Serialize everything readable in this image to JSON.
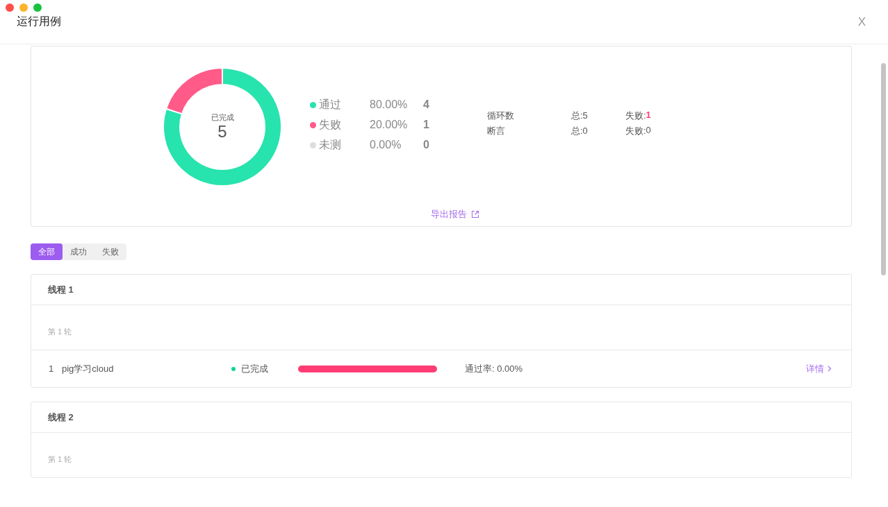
{
  "window": {
    "title": "运行用例",
    "close": "X"
  },
  "summary": {
    "chart_data": {
      "type": "donut",
      "categories": [
        "通过",
        "失败",
        "未测"
      ],
      "series": [
        {
          "values": [
            80,
            20,
            0
          ]
        }
      ],
      "colors": [
        "#27e3ad",
        "#ff5a88",
        "#dddddd"
      ]
    },
    "center_label": "已完成",
    "center_value": "5",
    "legend": [
      {
        "percent": "80.00%",
        "count": "4"
      },
      {
        "percent": "20.00%",
        "count": "1"
      },
      {
        "percent": "0.00%",
        "count": "0"
      }
    ],
    "stats": [
      {
        "label": "循环数",
        "total": "总:5",
        "fail_label": "失败:",
        "fail_value": "1",
        "highlight": true
      },
      {
        "label": "断言",
        "total": "总:0",
        "fail_label": "失败:",
        "fail_value": "0",
        "highlight": false
      }
    ],
    "export_link": "导出报告"
  },
  "filters": [
    {
      "label": "全部",
      "selected": true
    },
    {
      "label": "成功",
      "selected": false
    },
    {
      "label": "失败",
      "selected": false
    }
  ],
  "threads": [
    {
      "title": "线程 1",
      "rounds": [
        {
          "label": "第 1 轮",
          "cases": [
            {
              "index": "1",
              "name": "pig学习cloud",
              "status": "已完成",
              "color": "#10d39a",
              "level": 0,
              "rate": "通过率: 0.00%",
              "action": "详情"
            }
          ]
        }
      ]
    },
    {
      "title": "线程 2",
      "rounds": [
        {
          "label": "第 1 轮"
        }
      ]
    }
  ]
}
